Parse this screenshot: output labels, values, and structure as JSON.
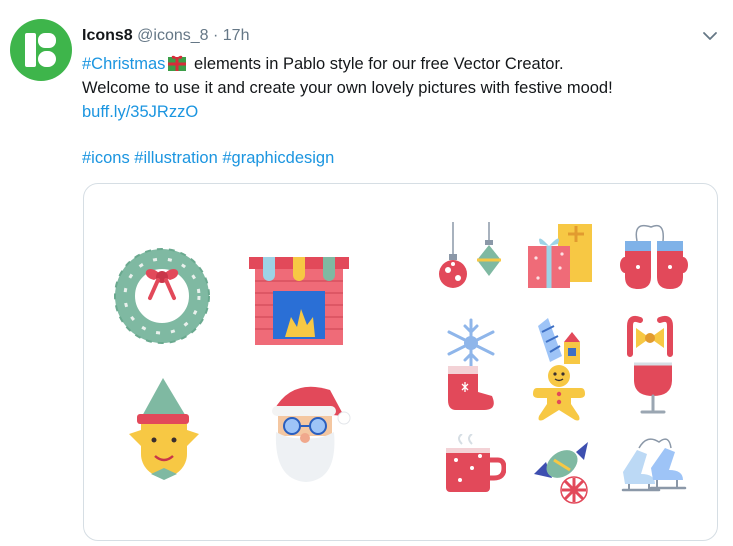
{
  "tweet": {
    "author_name": "Icons8",
    "author_handle": "@icons_8",
    "separator": "·",
    "time": "17h",
    "hashtag_christmas": "#Christmas",
    "gift_emoji": "gift-icon",
    "line1_rest": " elements in Pablo style for our free Vector Creator.",
    "line2": "Welcome to use it and create your own lovely pictures with festive mood!",
    "link": "buff.ly/35JRzzO",
    "hashtags": [
      "#icons",
      "#illustration",
      "#graphicdesign"
    ]
  },
  "media": {
    "illustrations": [
      "wreath-icon",
      "fireplace-icon",
      "elf-icon",
      "santa-icon",
      "ornaments-icon",
      "gift-box-icon",
      "mittens-icon",
      "snowflake-icon",
      "fireworks-icon",
      "candy-cane-bow-icon",
      "stocking-icon",
      "gingerbread-man-icon",
      "mulled-wine-icon",
      "hot-cocoa-icon",
      "candy-icon",
      "ice-skates-icon"
    ]
  },
  "colors": {
    "brand_green": "#3eb54b",
    "link_blue": "#1b95e0",
    "mint": "#7fb9a2",
    "red": "#e2495a",
    "yellow": "#f7c844"
  }
}
